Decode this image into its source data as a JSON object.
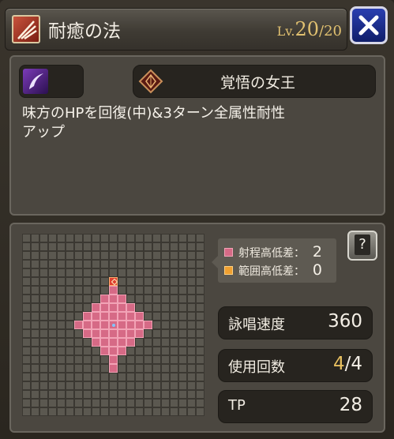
{
  "header": {
    "title": "耐癒の法",
    "level_label": "Lv.",
    "level_current": "20",
    "level_separator": "/",
    "level_max": "20"
  },
  "ability": {
    "name": "覚悟の女王",
    "description_line1": "味方のHPを回復(中)&3ターン全属性耐性",
    "description_line2": "アップ"
  },
  "range": {
    "range_height_label": "射程高低差：",
    "range_height_value": "2",
    "area_height_label": "範囲高低差：",
    "area_height_value": "0",
    "help_label": "?"
  },
  "stats": {
    "cast_speed_label": "詠唱速度",
    "cast_speed_value": "360",
    "uses_label": "使用回数",
    "uses_current": "4",
    "uses_separator": "/",
    "uses_max": "4",
    "tp_label": "TP",
    "tp_value": "28"
  },
  "colors": {
    "range_marker": "#e06a8a",
    "area_marker": "#f0a030",
    "close_button": "#1c2fa0"
  }
}
